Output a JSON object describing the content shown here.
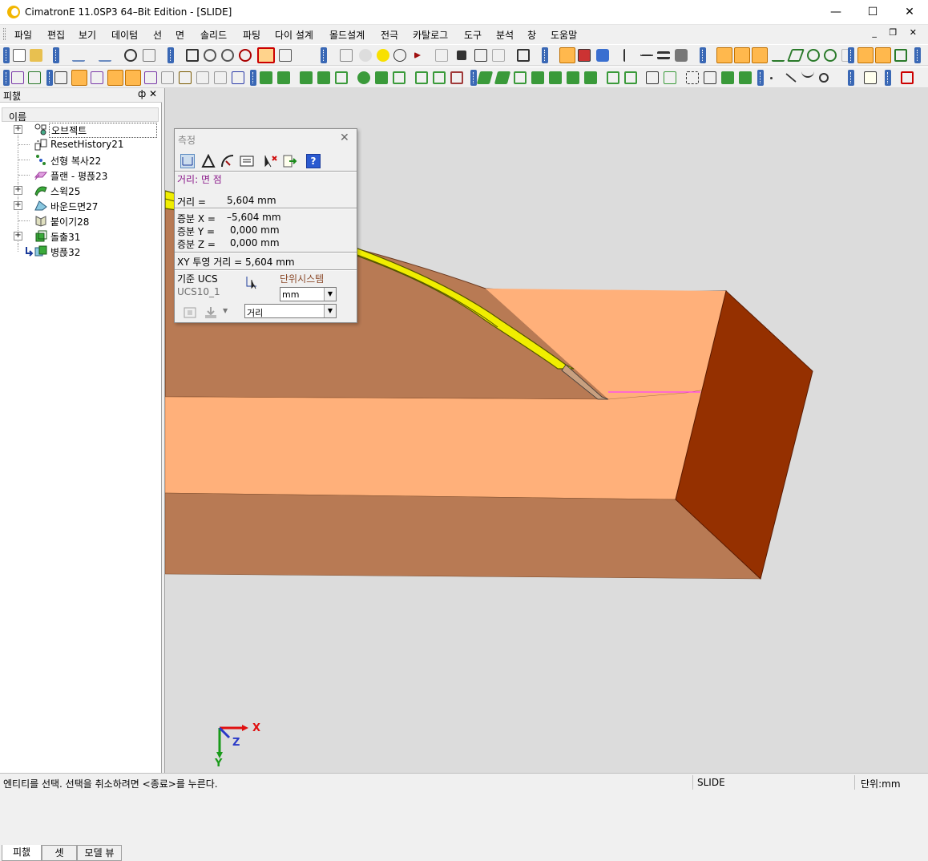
{
  "window": {
    "title": "CimatronE 11.0SP3 64–Bit Edition - [SLIDE]",
    "minimize": "—",
    "maximize": "☐",
    "close": "✕"
  },
  "menu": {
    "items": [
      "파일",
      "편집",
      "보기",
      "데이텀",
      "선",
      "면",
      "솔리드",
      "파팅",
      "다이 설계",
      "몰드설계",
      "전극",
      "카탈로그",
      "도구",
      "분석",
      "창",
      "도움말"
    ],
    "mdi_buttons": "_ ❐ ✕"
  },
  "feature_panel": {
    "title": "피챐",
    "pin": "ф",
    "close": "✕",
    "column_header": "이름",
    "items": [
      {
        "label": "오브젝트",
        "icon": "object-icon",
        "expandable": true
      },
      {
        "label": "ResetHistory21",
        "icon": "reset-history-icon",
        "expandable": false
      },
      {
        "label": "선형 복사22",
        "icon": "linear-copy-icon",
        "expandable": false
      },
      {
        "label": "플랜 - 평픉23",
        "icon": "plane-parallel-icon",
        "expandable": false
      },
      {
        "label": "스윅25",
        "icon": "sweep-icon",
        "expandable": true
      },
      {
        "label": "바운드면27",
        "icon": "bound-surface-icon",
        "expandable": true
      },
      {
        "label": "붙이기28",
        "icon": "attach-icon",
        "expandable": false
      },
      {
        "label": "돌출31",
        "icon": "extrude-icon",
        "expandable": true
      },
      {
        "label": "병픉32",
        "icon": "merge-icon",
        "expandable": false
      }
    ],
    "tabs": [
      "피챐",
      "셋",
      "모델 뷰"
    ]
  },
  "measure_dialog": {
    "title": "측정",
    "close": "✕",
    "mode": "거리:  면 점",
    "distance_label": "거리 =",
    "distance_value": "5,604 mm",
    "dx_label": "증분 X =",
    "dx_value": "–5,604 mm",
    "dy_label": "증분 Y =",
    "dy_value": "0,000 mm",
    "dz_label": "증분 Z =",
    "dz_value": "0,000 mm",
    "xy_projection": "XY 투영 거리 = 5,604 mm",
    "ucs_label": "기준 UCS",
    "ucs_value": "UCS10_1",
    "units_label": "단위시스템",
    "units_value": "mm",
    "type_value": "거리"
  },
  "axis_triad": {
    "x": "X",
    "y": "Y",
    "z": "Z"
  },
  "status": {
    "prompt": "엔티티를 선택. 선택을 취소하려면 <종료>를 누른다.",
    "file": "SLIDE",
    "units": "단위:mm"
  },
  "colors": {
    "face_light": "#ffb07a",
    "face_dark": "#b87a54",
    "face_end": "#953000",
    "sweep": "#f0ee00",
    "viewport_bg": "#dcdcdc",
    "toolbar_grip": "#3a68b5"
  }
}
